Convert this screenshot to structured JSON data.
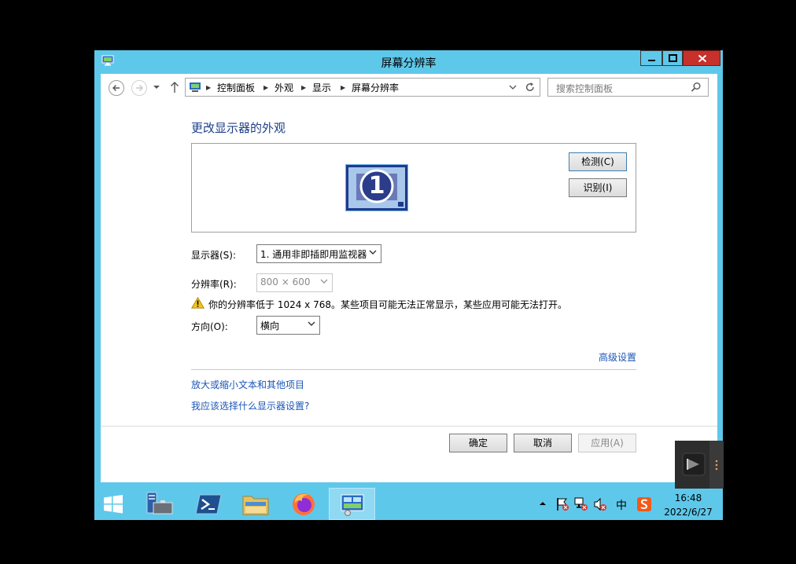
{
  "window": {
    "title": "屏幕分辨率"
  },
  "nav": {
    "breadcrumbs": [
      "控制面板",
      "外观",
      "显示",
      "屏幕分辨率"
    ],
    "search_placeholder": "搜索控制面板"
  },
  "main": {
    "heading": "更改显示器的外观",
    "detect_label": "检测(C)",
    "identify_label": "识别(I)",
    "monitor_number": "1",
    "display_label": "显示器(S):",
    "display_value": "1. 通用非即插即用监视器",
    "resolution_label": "分辨率(R):",
    "resolution_value": "800 × 600",
    "warning_text": "你的分辨率低于 1024 x 768。某些项目可能无法正常显示，某些应用可能无法打开。",
    "orientation_label": "方向(O):",
    "orientation_value": "横向",
    "advanced_link": "高级设置",
    "link_text_size": "放大或缩小文本和其他项目",
    "link_which_settings": "我应该选择什么显示器设置?"
  },
  "buttons": {
    "ok": "确定",
    "cancel": "取消",
    "apply": "应用(A)"
  },
  "taskbar": {
    "ime_label": "中",
    "time": "16:48",
    "date": "2022/6/27"
  },
  "colors": {
    "accent": "#5ec8ea",
    "close": "#c7302b",
    "link": "#1b56b8",
    "heading": "#1d3f8a"
  }
}
